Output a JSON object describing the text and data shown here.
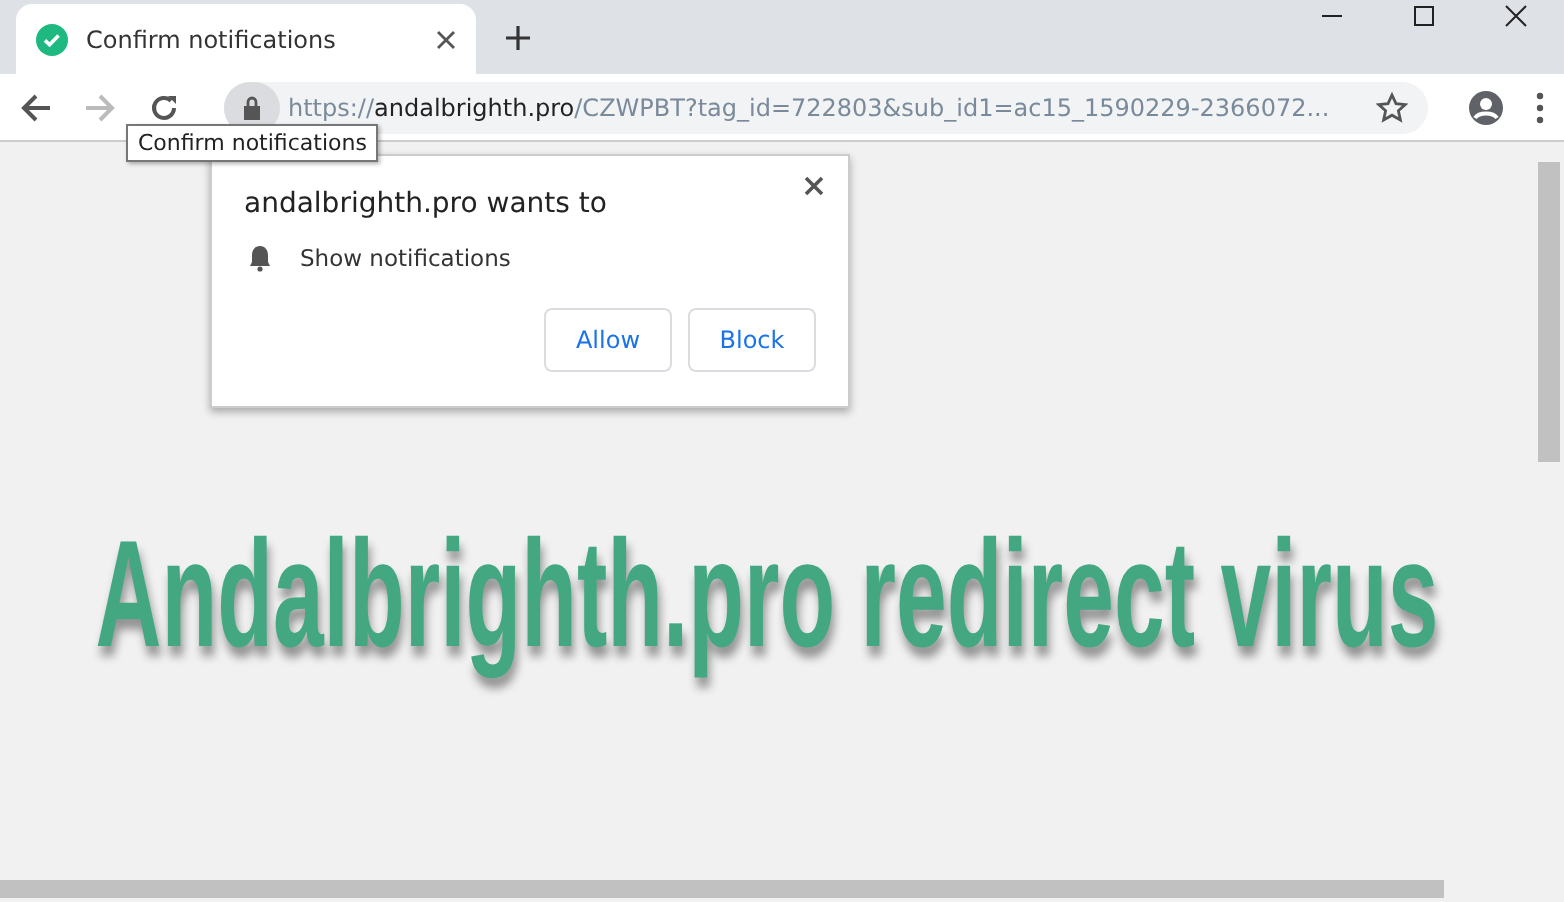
{
  "tabs": [
    {
      "title": "Confirm notifications",
      "selected": true
    }
  ],
  "toolbar": {
    "url_scheme": "https://",
    "url_host": "andalbrighth.pro",
    "url_path": "/CZWPBT?tag_id=722803&sub_id1=ac15_1590229-2366072...",
    "tooltip": "Confirm notifications"
  },
  "permission_popup": {
    "heading": "andalbrighth.pro wants to",
    "permission": "Show notifications",
    "buttons": [
      "Allow",
      "Block"
    ]
  },
  "overlay_title": "Andalbrighth.pro redirect virus"
}
